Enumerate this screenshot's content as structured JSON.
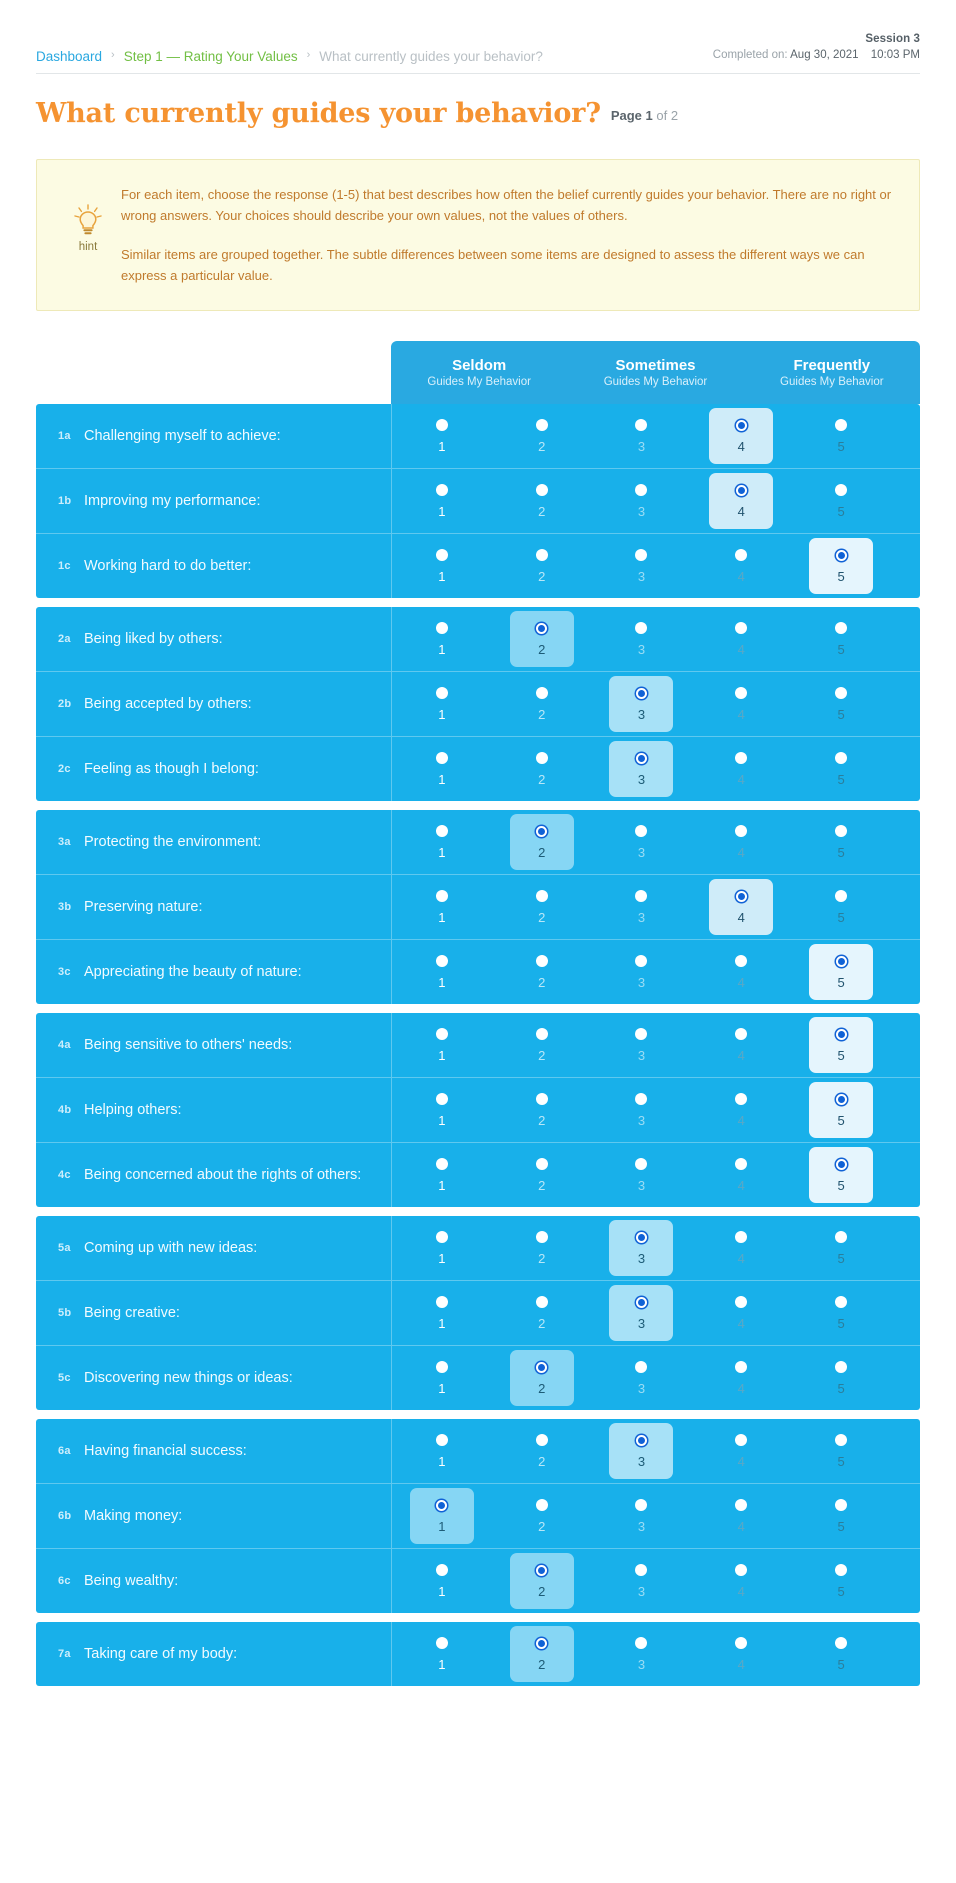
{
  "breadcrumb": {
    "items": [
      {
        "label": "Dashboard",
        "kind": "dashboard"
      },
      {
        "label": "Step 1  — Rating Your Values",
        "kind": "step"
      },
      {
        "label": "What currently guides your behavior?",
        "kind": "current"
      }
    ],
    "separator": "›"
  },
  "session": {
    "title": "Session 3",
    "completed_prefix": "Completed on:",
    "date": "Aug 30, 2021",
    "time": "10:03 PM"
  },
  "header": {
    "title": "What currently guides your behavior?",
    "page_label": "Page 1",
    "page_total": "of 2"
  },
  "hint": {
    "icon": "lightbulb-icon",
    "label": "hint",
    "paragraphs": [
      "For each item, choose the response (1-5) that best describes how often the belief currently guides your behavior. There are no right or wrong answers. Your choices should describe your own values, not the values of others.",
      "Similar items are grouped together. The subtle differences between some items are designed to assess the different ways we can express a particular value."
    ]
  },
  "scale": {
    "headers": [
      {
        "title": "Seldom",
        "sub": "Guides My Behavior"
      },
      {
        "title": "Sometimes",
        "sub": "Guides My Behavior"
      },
      {
        "title": "Frequently",
        "sub": "Guides My Behavior"
      }
    ],
    "options": [
      "1",
      "2",
      "3",
      "4",
      "5"
    ]
  },
  "colors": {
    "row_blue": "#18b0ea",
    "header_blue": "#29a9e1",
    "accent_orange": "#f59331",
    "crumb_blue": "#2aa8e0",
    "crumb_green": "#72bf44",
    "hint_bg": "#fcfbe3",
    "hint_text": "#c07a2c",
    "selected_dot": "#1062d6"
  },
  "groups": [
    {
      "rows": [
        {
          "code": "1a",
          "text": "Challenging myself to achieve:",
          "selected": 4
        },
        {
          "code": "1b",
          "text": "Improving my performance:",
          "selected": 4
        },
        {
          "code": "1c",
          "text": "Working hard to do better:",
          "selected": 5
        }
      ]
    },
    {
      "rows": [
        {
          "code": "2a",
          "text": "Being liked by others:",
          "selected": 2
        },
        {
          "code": "2b",
          "text": "Being accepted by others:",
          "selected": 3
        },
        {
          "code": "2c",
          "text": "Feeling as though I belong:",
          "selected": 3
        }
      ]
    },
    {
      "rows": [
        {
          "code": "3a",
          "text": "Protecting the environment:",
          "selected": 2
        },
        {
          "code": "3b",
          "text": "Preserving nature:",
          "selected": 4
        },
        {
          "code": "3c",
          "text": "Appreciating the beauty of nature:",
          "selected": 5
        }
      ]
    },
    {
      "rows": [
        {
          "code": "4a",
          "text": "Being sensitive to others' needs:",
          "selected": 5
        },
        {
          "code": "4b",
          "text": "Helping others:",
          "selected": 5
        },
        {
          "code": "4c",
          "text": "Being concerned about the rights of others:",
          "selected": 5
        }
      ]
    },
    {
      "rows": [
        {
          "code": "5a",
          "text": "Coming up with new ideas:",
          "selected": 3
        },
        {
          "code": "5b",
          "text": "Being creative:",
          "selected": 3
        },
        {
          "code": "5c",
          "text": "Discovering new things or ideas:",
          "selected": 2
        }
      ]
    },
    {
      "rows": [
        {
          "code": "6a",
          "text": "Having financial success:",
          "selected": 3
        },
        {
          "code": "6b",
          "text": "Making money:",
          "selected": 1
        },
        {
          "code": "6c",
          "text": "Being wealthy:",
          "selected": 2
        }
      ]
    },
    {
      "rows": [
        {
          "code": "7a",
          "text": "Taking care of my body:",
          "selected": 2
        }
      ]
    }
  ]
}
